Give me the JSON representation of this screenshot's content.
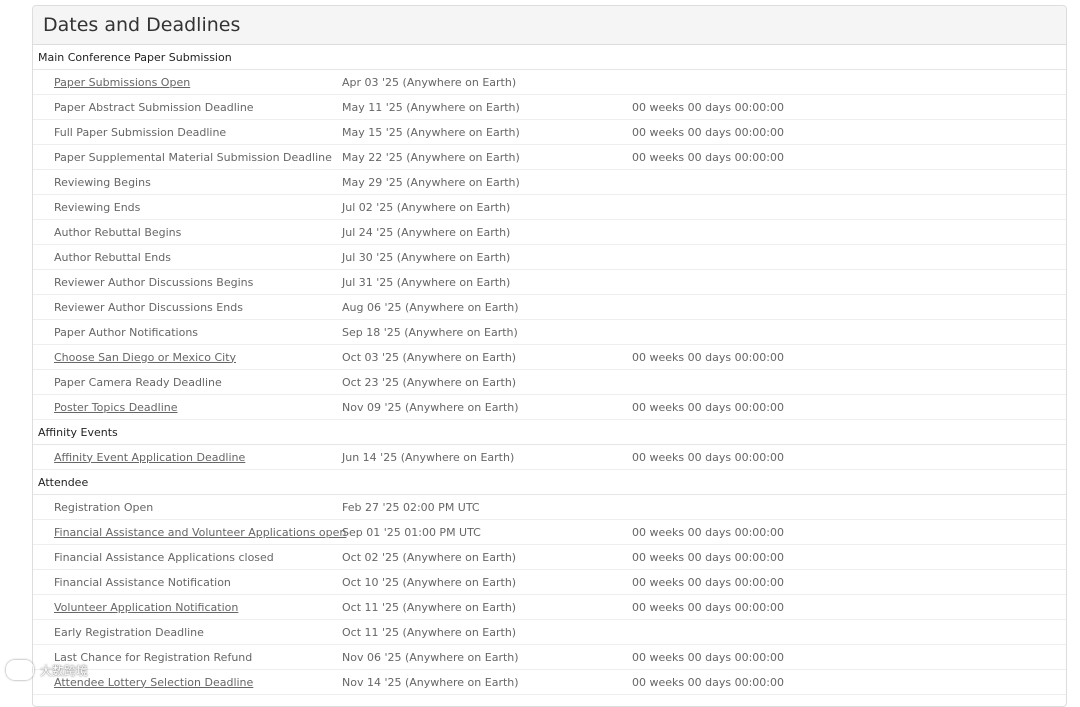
{
  "panel": {
    "title": "Dates and Deadlines"
  },
  "sections": [
    {
      "title": "Main Conference Paper Submission",
      "rows": [
        {
          "name": "Paper Submissions Open",
          "link": true,
          "date": "Apr 03 '25 (Anywhere on Earth)",
          "countdown": ""
        },
        {
          "name": "Paper Abstract Submission Deadline",
          "link": false,
          "date": "May 11 '25 (Anywhere on Earth)",
          "countdown": "00 weeks 00 days 00:00:00"
        },
        {
          "name": "Full Paper Submission Deadline",
          "link": false,
          "date": "May 15 '25 (Anywhere on Earth)",
          "countdown": "00 weeks 00 days 00:00:00"
        },
        {
          "name": "Paper Supplemental Material Submission Deadline",
          "link": false,
          "date": "May 22 '25 (Anywhere on Earth)",
          "countdown": "00 weeks 00 days 00:00:00"
        },
        {
          "name": "Reviewing Begins",
          "link": false,
          "date": "May 29 '25 (Anywhere on Earth)",
          "countdown": ""
        },
        {
          "name": "Reviewing Ends",
          "link": false,
          "date": "Jul 02 '25 (Anywhere on Earth)",
          "countdown": ""
        },
        {
          "name": "Author Rebuttal Begins",
          "link": false,
          "date": "Jul 24 '25 (Anywhere on Earth)",
          "countdown": ""
        },
        {
          "name": "Author Rebuttal Ends",
          "link": false,
          "date": "Jul 30 '25 (Anywhere on Earth)",
          "countdown": ""
        },
        {
          "name": "Reviewer Author Discussions Begins",
          "link": false,
          "date": "Jul 31 '25 (Anywhere on Earth)",
          "countdown": ""
        },
        {
          "name": "Reviewer Author Discussions Ends",
          "link": false,
          "date": "Aug 06 '25 (Anywhere on Earth)",
          "countdown": ""
        },
        {
          "name": "Paper Author Notifications",
          "link": false,
          "date": "Sep 18 '25 (Anywhere on Earth)",
          "countdown": ""
        },
        {
          "name": "Choose San Diego or Mexico City",
          "link": true,
          "date": "Oct 03 '25 (Anywhere on Earth)",
          "countdown": "00 weeks 00 days 00:00:00"
        },
        {
          "name": "Paper Camera Ready Deadline",
          "link": false,
          "date": "Oct 23 '25 (Anywhere on Earth)",
          "countdown": ""
        },
        {
          "name": "Poster Topics Deadline",
          "link": true,
          "date": "Nov 09 '25 (Anywhere on Earth)",
          "countdown": "00 weeks 00 days 00:00:00"
        }
      ]
    },
    {
      "title": "Affinity Events",
      "rows": [
        {
          "name": "Affinity Event Application Deadline",
          "link": true,
          "date": "Jun 14 '25 (Anywhere on Earth)",
          "countdown": "00 weeks 00 days 00:00:00"
        }
      ]
    },
    {
      "title": "Attendee",
      "rows": [
        {
          "name": "Registration Open",
          "link": false,
          "date": "Feb 27 '25 02:00 PM UTC",
          "countdown": ""
        },
        {
          "name": "Financial Assistance and Volunteer Applications open",
          "link": true,
          "date": "Sep 01 '25 01:00 PM UTC",
          "countdown": "00 weeks 00 days 00:00:00"
        },
        {
          "name": "Financial Assistance Applications closed",
          "link": false,
          "date": "Oct 02 '25 (Anywhere on Earth)",
          "countdown": "00 weeks 00 days 00:00:00"
        },
        {
          "name": "Financial Assistance Notification",
          "link": false,
          "date": "Oct 10 '25 (Anywhere on Earth)",
          "countdown": "00 weeks 00 days 00:00:00"
        },
        {
          "name": "Volunteer Application Notification",
          "link": true,
          "date": "Oct 11 '25 (Anywhere on Earth)",
          "countdown": "00 weeks 00 days 00:00:00"
        },
        {
          "name": "Early Registration Deadline",
          "link": false,
          "date": "Oct 11 '25 (Anywhere on Earth)",
          "countdown": ""
        },
        {
          "name": "Last Chance for Registration Refund",
          "link": false,
          "date": "Nov 06 '25 (Anywhere on Earth)",
          "countdown": "00 weeks 00 days 00:00:00"
        },
        {
          "name": "Attendee Lottery Selection Deadline",
          "link": true,
          "date": "Nov 14 '25 (Anywhere on Earth)",
          "countdown": "00 weeks 00 days 00:00:00"
        }
      ]
    }
  ],
  "watermark": {
    "text": "大数跨境"
  }
}
